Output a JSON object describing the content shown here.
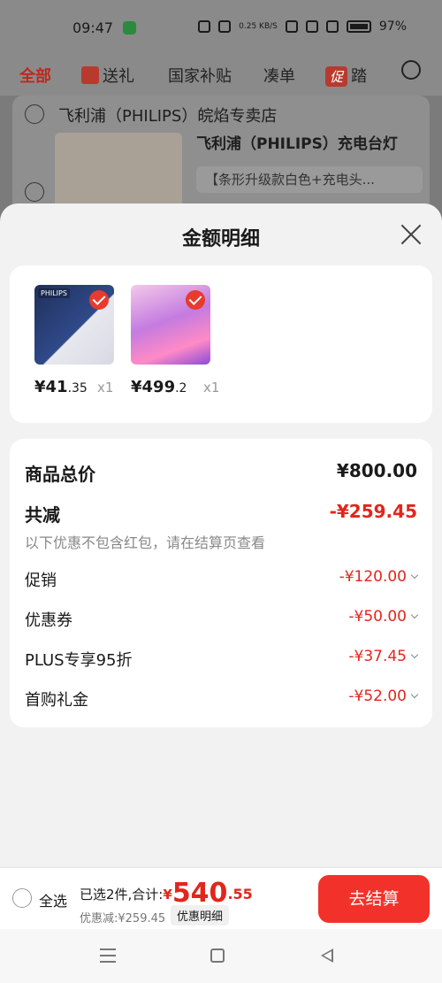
{
  "status_bar": {
    "time": "09:47",
    "net_speed": "0.25 KB/S",
    "battery": "97%"
  },
  "background": {
    "nav": {
      "all": "全部",
      "gift": "送礼",
      "subsidy": "国家补贴",
      "bundle": "凑单",
      "promo_badge": "促",
      "promo_text": "踏"
    },
    "store_name": "飞利浦（PHILIPS）皖焰专卖店",
    "product_title": "飞利浦（PHILIPS）充电台灯",
    "sku": "【条形升级款白色+充电头..."
  },
  "sheet": {
    "title": "金额明细",
    "items": [
      {
        "price_int": "¥41",
        "price_dec": ".35",
        "qty": "x1",
        "image_label": "PHILIPS"
      },
      {
        "price_int": "¥499",
        "price_dec": ".2",
        "qty": "x1",
        "image_label": ""
      }
    ],
    "detail": {
      "total_label": "商品总价",
      "total_value": "¥800.00",
      "reduce_label": "共减",
      "reduce_value": "-¥259.45",
      "note": "以下优惠不包含红包，请在结算页查看",
      "rows": [
        {
          "label": "促销",
          "value": "-¥120.00"
        },
        {
          "label": "优惠券",
          "value": "-¥50.00"
        },
        {
          "label": "PLUS专享95折",
          "value": "-¥37.45"
        },
        {
          "label": "首购礼金",
          "value": "-¥52.00"
        }
      ]
    }
  },
  "bottom": {
    "select_all": "全选",
    "summary_prefix": "已选2件,合计:",
    "currency": "¥",
    "amount_int": "540",
    "amount_dec": ".55",
    "saved": "优惠减:¥259.45",
    "detail_button": "优惠明细",
    "checkout": "去结算"
  }
}
